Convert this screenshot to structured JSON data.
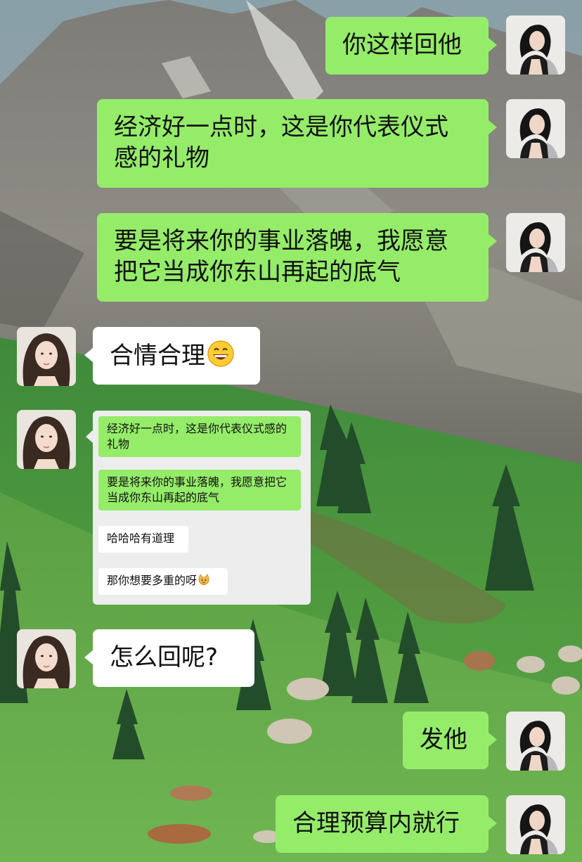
{
  "messages": [
    {
      "id": "m1",
      "side": "right",
      "text": "你这样回他"
    },
    {
      "id": "m2",
      "side": "right",
      "text": "经济好一点时，这是你代表仪式感的礼物"
    },
    {
      "id": "m3",
      "side": "right",
      "text": "要是将来你的事业落魄，我愿意把它当成你东山再起的底气"
    },
    {
      "id": "m4",
      "side": "left",
      "text": "合情合理",
      "emoji": "grinning-face-icon"
    },
    {
      "id": "m6",
      "side": "left",
      "text": "怎么回呢?"
    },
    {
      "id": "m7",
      "side": "right",
      "text": "发他"
    },
    {
      "id": "m8",
      "side": "right",
      "text": "合理预算内就行"
    }
  ],
  "screenshot_card": {
    "items": [
      {
        "style": "green",
        "text": "经济好一点时，这是你代表仪式感的礼物"
      },
      {
        "style": "green",
        "text": "要是将来你的事业落魄，我愿意把它当成你东山再起的底气"
      },
      {
        "style": "white",
        "text": "哈哈哈有道理"
      },
      {
        "style": "white",
        "text": "那你想要多重的呀",
        "emoji": "cat-face-icon"
      }
    ]
  },
  "colors": {
    "self_bubble": "#95ec69",
    "other_bubble": "#ffffff",
    "quote_card": "#ededed"
  },
  "icons": {
    "self_avatar": "woman-dark-hair-avatar",
    "other_avatar": "woman-wavy-hair-avatar"
  }
}
